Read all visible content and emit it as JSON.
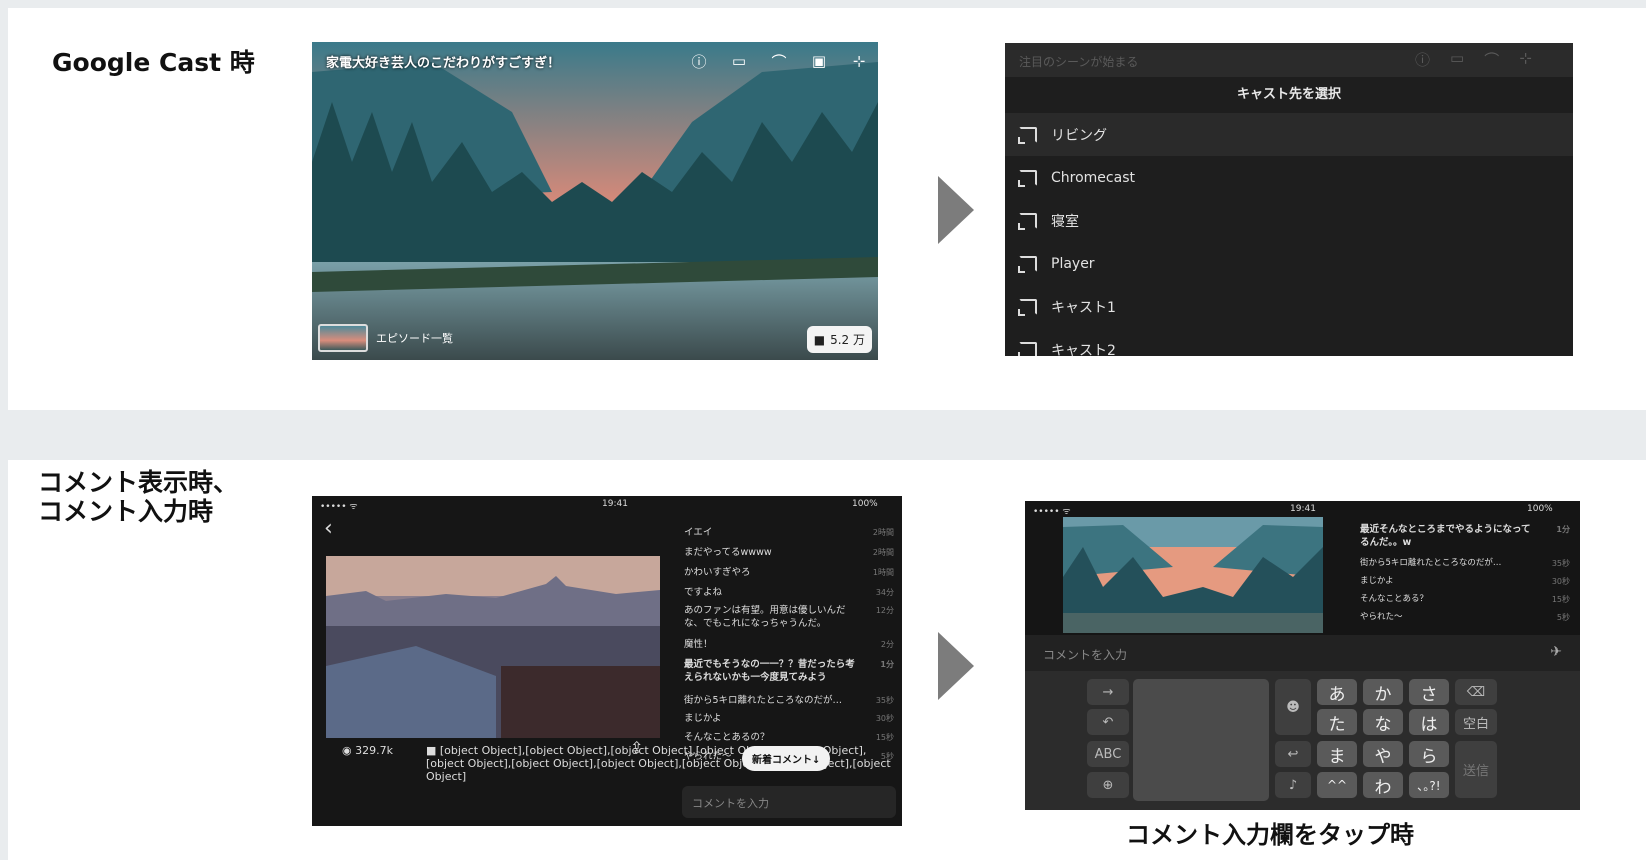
{
  "sections": {
    "cast_title": "Google Cast 時",
    "comment_title": "コメント表示時、\nコメント入力時",
    "tap_caption": "コメント入力欄をタップ時"
  },
  "player": {
    "title": "家電大好き芸人のこだわりがすごすぎ！",
    "episodes": "エピソード一覧",
    "count": "5.2 万",
    "icons": [
      "info-icon",
      "airplay-icon",
      "cast-icon",
      "settings-icon",
      "exit-fullscreen-icon"
    ]
  },
  "cast": {
    "bg_title": "注目のシーンが始まる",
    "header": "キャスト先を選択",
    "items": [
      "リビング",
      "Chromecast",
      "寝室",
      "Player",
      "キャスト1",
      "キャスト2"
    ]
  },
  "comment_screen": {
    "time": "19:41",
    "battery": "100%",
    "views": "329.7k",
    "comments": [
      {
        "text": "イエイ",
        "time": "2時間"
      },
      {
        "text": "まだやってるwwww",
        "time": "2時間"
      },
      {
        "text": "かわいすぎやろ",
        "time": "1時間"
      },
      {
        "text": "ですよね",
        "time": "34分"
      },
      {
        "text": "あのファンは有望。用意は優しいんだな、でもこれになっちゃうんだ。",
        "time": "12分"
      },
      {
        "text": "魔性！",
        "time": "2分"
      },
      {
        "text": "最近でもそうなの一一？？昔だったら考えられないかも一今度見てみよう",
        "time": "1分"
      },
      {
        "text": "街から5キロ離れたところなのだが…",
        "time": "35秒"
      },
      {
        "text": "まじかよ",
        "time": "30秒"
      },
      {
        "text": "そんなことあるの？",
        "time": "15秒"
      },
      {
        "text": "やられた〜",
        "time": "5秒"
      }
    ],
    "new_comment": "新着コメント↓",
    "input_placeholder": "コメントを入力"
  },
  "keyboard_screen": {
    "time": "19:41",
    "battery": "100%",
    "input_placeholder": "コメントを入力",
    "comments": [
      {
        "text": "最近そんなところまでやるようになってるんだ。。w",
        "time": "1分"
      },
      {
        "text": "街から5キロ離れたところなのだが…",
        "time": "35秒"
      },
      {
        "text": "まじかよ",
        "time": "30秒"
      },
      {
        "text": "そんなことある？",
        "time": "15秒"
      },
      {
        "text": "やられた〜",
        "time": "5秒"
      }
    ],
    "keys": {
      "row1": [
        "あ",
        "か",
        "さ"
      ],
      "row2": [
        "た",
        "な",
        "は"
      ],
      "row3": [
        "ま",
        "や",
        "ら"
      ],
      "row4": [
        "^^",
        "わ",
        "､｡?!"
      ],
      "space": "空白",
      "send": "送信",
      "abc": "ABC"
    }
  }
}
